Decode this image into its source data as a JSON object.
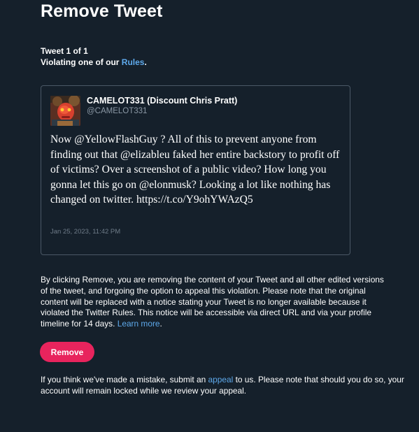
{
  "title": "Remove Tweet",
  "tweet_counter": "Tweet 1 of 1",
  "violation": {
    "prefix": "Violating one of our ",
    "rules_link": "Rules",
    "suffix": "."
  },
  "tweet": {
    "display_name": "CAMELOT331 (Discount Chris Pratt)",
    "handle": "@CAMELOT331",
    "text": "Now @YellowFlashGuy ? All of this to prevent anyone from finding out that @elizableu faked her entire backstory to profit off of victims? Over a screenshot of a public video? How long you gonna let this go on @elonmusk? Looking a lot like nothing has changed on twitter. https://t.co/Y9ohYWAzQ5",
    "date": "Jan 25, 2023, 11:42 PM",
    "avatar_icon": "user-avatar"
  },
  "disclaimer": {
    "text": "By clicking Remove, you are removing the content of your Tweet and all other edited versions of the tweet, and forgoing the option to appeal this violation. Please note that the original content will be replaced with a notice stating your Tweet is no longer available because it violated the Twitter Rules. This notice will be accessible via direct URL and via your profile timeline for 14 days. ",
    "learn_more": "Learn more",
    "suffix": "."
  },
  "remove_button": "Remove",
  "appeal": {
    "prefix": "If you think we've made a mistake, submit an ",
    "link": "appeal",
    "suffix": " to us. Please note that should you do so, your account will remain locked while we review your appeal."
  },
  "colors": {
    "background": "#15202b",
    "link": "#5ea9eb",
    "button": "#e8245d",
    "card_border": "#4b5866",
    "muted": "#8b98a5"
  }
}
